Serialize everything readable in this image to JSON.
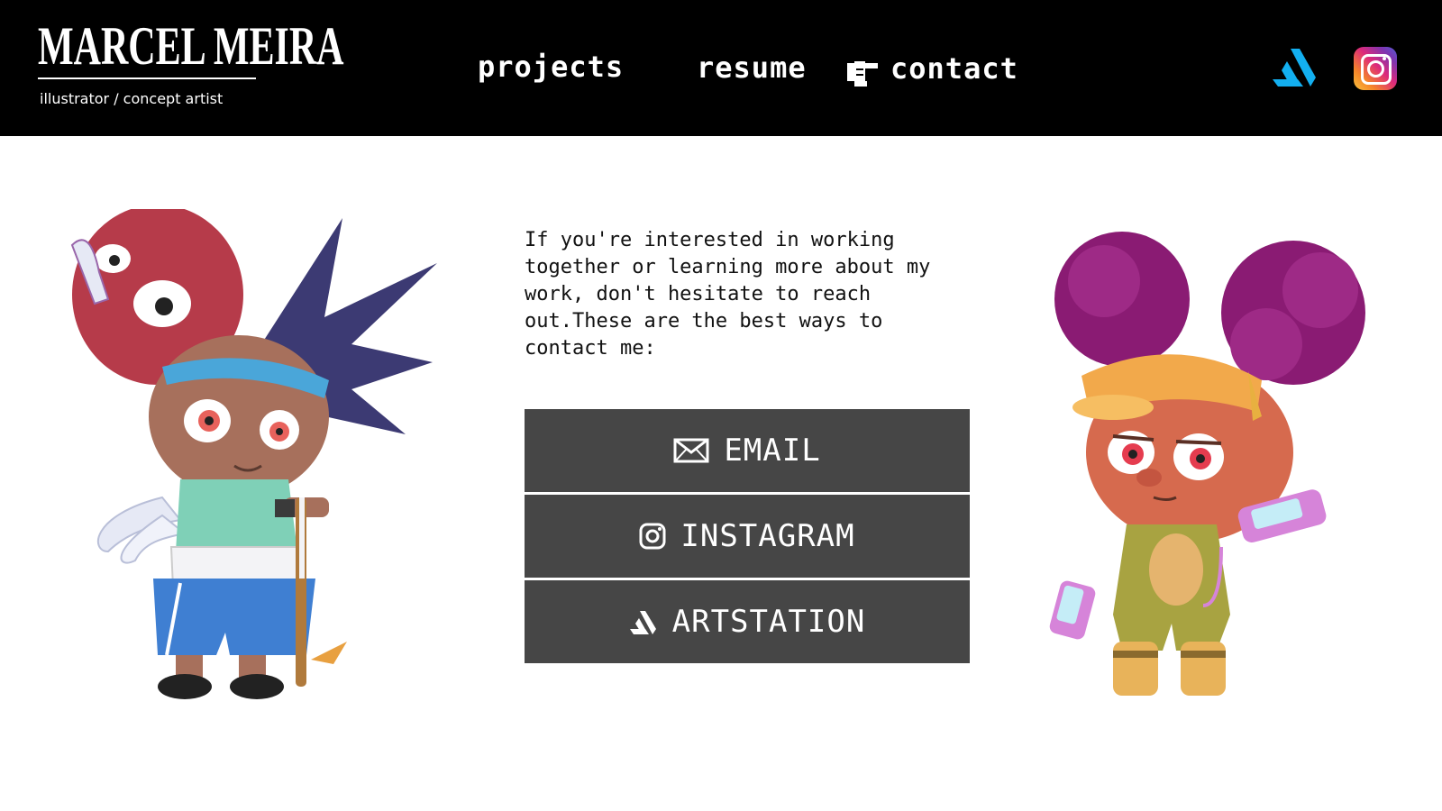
{
  "header": {
    "logo_title": "MARCEL MEIRA",
    "logo_subtitle": "illustrator / concept artist",
    "nav": {
      "projects": "projects",
      "resume": "resume",
      "contact": "contact"
    },
    "icons": {
      "contact_pointer": "pointing-hand-icon",
      "artstation": "artstation-icon",
      "instagram": "instagram-icon"
    }
  },
  "main": {
    "intro_text": "If you're interested in working together or learning more about my work, don't hesitate to reach out.These are the best ways to contact me:",
    "buttons": {
      "email": "EMAIL",
      "instagram": "INSTAGRAM",
      "artstation": "ARTSTATION"
    }
  },
  "colors": {
    "header_bg": "#000000",
    "button_bg": "#464646",
    "artstation_blue": "#13aff0"
  }
}
